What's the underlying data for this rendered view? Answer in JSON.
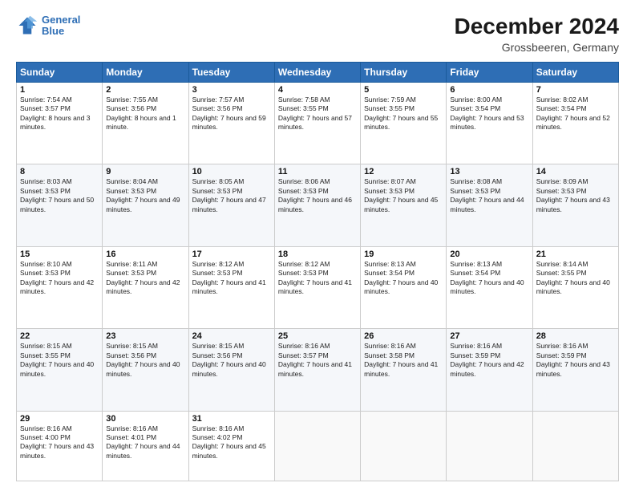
{
  "header": {
    "logo_line1": "General",
    "logo_line2": "Blue",
    "main_title": "December 2024",
    "subtitle": "Grossbeeren, Germany"
  },
  "calendar": {
    "days_of_week": [
      "Sunday",
      "Monday",
      "Tuesday",
      "Wednesday",
      "Thursday",
      "Friday",
      "Saturday"
    ],
    "weeks": [
      [
        {
          "day": "1",
          "sunrise": "7:54 AM",
          "sunset": "3:57 PM",
          "daylight": "8 hours and 3 minutes."
        },
        {
          "day": "2",
          "sunrise": "7:55 AM",
          "sunset": "3:56 PM",
          "daylight": "8 hours and 1 minute."
        },
        {
          "day": "3",
          "sunrise": "7:57 AM",
          "sunset": "3:56 PM",
          "daylight": "7 hours and 59 minutes."
        },
        {
          "day": "4",
          "sunrise": "7:58 AM",
          "sunset": "3:55 PM",
          "daylight": "7 hours and 57 minutes."
        },
        {
          "day": "5",
          "sunrise": "7:59 AM",
          "sunset": "3:55 PM",
          "daylight": "7 hours and 55 minutes."
        },
        {
          "day": "6",
          "sunrise": "8:00 AM",
          "sunset": "3:54 PM",
          "daylight": "7 hours and 53 minutes."
        },
        {
          "day": "7",
          "sunrise": "8:02 AM",
          "sunset": "3:54 PM",
          "daylight": "7 hours and 52 minutes."
        }
      ],
      [
        {
          "day": "8",
          "sunrise": "8:03 AM",
          "sunset": "3:53 PM",
          "daylight": "7 hours and 50 minutes."
        },
        {
          "day": "9",
          "sunrise": "8:04 AM",
          "sunset": "3:53 PM",
          "daylight": "7 hours and 49 minutes."
        },
        {
          "day": "10",
          "sunrise": "8:05 AM",
          "sunset": "3:53 PM",
          "daylight": "7 hours and 47 minutes."
        },
        {
          "day": "11",
          "sunrise": "8:06 AM",
          "sunset": "3:53 PM",
          "daylight": "7 hours and 46 minutes."
        },
        {
          "day": "12",
          "sunrise": "8:07 AM",
          "sunset": "3:53 PM",
          "daylight": "7 hours and 45 minutes."
        },
        {
          "day": "13",
          "sunrise": "8:08 AM",
          "sunset": "3:53 PM",
          "daylight": "7 hours and 44 minutes."
        },
        {
          "day": "14",
          "sunrise": "8:09 AM",
          "sunset": "3:53 PM",
          "daylight": "7 hours and 43 minutes."
        }
      ],
      [
        {
          "day": "15",
          "sunrise": "8:10 AM",
          "sunset": "3:53 PM",
          "daylight": "7 hours and 42 minutes."
        },
        {
          "day": "16",
          "sunrise": "8:11 AM",
          "sunset": "3:53 PM",
          "daylight": "7 hours and 42 minutes."
        },
        {
          "day": "17",
          "sunrise": "8:12 AM",
          "sunset": "3:53 PM",
          "daylight": "7 hours and 41 minutes."
        },
        {
          "day": "18",
          "sunrise": "8:12 AM",
          "sunset": "3:53 PM",
          "daylight": "7 hours and 41 minutes."
        },
        {
          "day": "19",
          "sunrise": "8:13 AM",
          "sunset": "3:54 PM",
          "daylight": "7 hours and 40 minutes."
        },
        {
          "day": "20",
          "sunrise": "8:13 AM",
          "sunset": "3:54 PM",
          "daylight": "7 hours and 40 minutes."
        },
        {
          "day": "21",
          "sunrise": "8:14 AM",
          "sunset": "3:55 PM",
          "daylight": "7 hours and 40 minutes."
        }
      ],
      [
        {
          "day": "22",
          "sunrise": "8:15 AM",
          "sunset": "3:55 PM",
          "daylight": "7 hours and 40 minutes."
        },
        {
          "day": "23",
          "sunrise": "8:15 AM",
          "sunset": "3:56 PM",
          "daylight": "7 hours and 40 minutes."
        },
        {
          "day": "24",
          "sunrise": "8:15 AM",
          "sunset": "3:56 PM",
          "daylight": "7 hours and 40 minutes."
        },
        {
          "day": "25",
          "sunrise": "8:16 AM",
          "sunset": "3:57 PM",
          "daylight": "7 hours and 41 minutes."
        },
        {
          "day": "26",
          "sunrise": "8:16 AM",
          "sunset": "3:58 PM",
          "daylight": "7 hours and 41 minutes."
        },
        {
          "day": "27",
          "sunrise": "8:16 AM",
          "sunset": "3:59 PM",
          "daylight": "7 hours and 42 minutes."
        },
        {
          "day": "28",
          "sunrise": "8:16 AM",
          "sunset": "3:59 PM",
          "daylight": "7 hours and 43 minutes."
        }
      ],
      [
        {
          "day": "29",
          "sunrise": "8:16 AM",
          "sunset": "4:00 PM",
          "daylight": "7 hours and 43 minutes."
        },
        {
          "day": "30",
          "sunrise": "8:16 AM",
          "sunset": "4:01 PM",
          "daylight": "7 hours and 44 minutes."
        },
        {
          "day": "31",
          "sunrise": "8:16 AM",
          "sunset": "4:02 PM",
          "daylight": "7 hours and 45 minutes."
        },
        null,
        null,
        null,
        null
      ]
    ],
    "labels": {
      "sunrise": "Sunrise: ",
      "sunset": "Sunset: ",
      "daylight": "Daylight: "
    }
  }
}
